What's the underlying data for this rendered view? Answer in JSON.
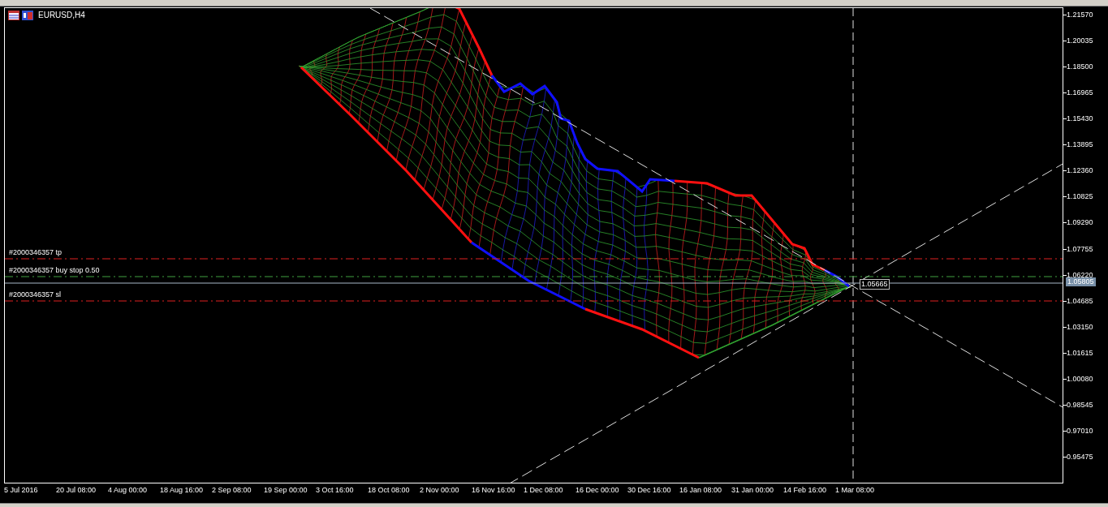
{
  "chart": {
    "title": "EURUSD,H4",
    "price_ticks": [
      "1.21570",
      "1.20035",
      "1.18500",
      "1.16965",
      "1.15430",
      "1.13895",
      "1.12360",
      "1.10825",
      "1.09290",
      "1.07755",
      "1.06220",
      "1.04685",
      "1.03150",
      "1.01615",
      "1.00080",
      "0.98545",
      "0.97010",
      "0.95475"
    ],
    "time_ticks": [
      "5 Jul 2016",
      "20 Jul 08:00",
      "4 Aug 00:00",
      "18 Aug 16:00",
      "2 Sep 08:00",
      "19 Sep 00:00",
      "3 Oct 16:00",
      "18 Oct 08:00",
      "2 Nov 00:00",
      "16 Nov 16:00",
      "1 Dec 08:00",
      "16 Dec 00:00",
      "30 Dec 16:00",
      "16 Jan 08:00",
      "31 Jan 00:00",
      "14 Feb 16:00",
      "1 Mar 08:00"
    ],
    "order_lines": [
      {
        "kind": "tp",
        "label": "#2000346357 tp"
      },
      {
        "kind": "entry",
        "label": "#2000346357 buy stop 0.50"
      },
      {
        "kind": "sl",
        "label": "#2000346357 sl"
      }
    ],
    "bid_price": "1.05805",
    "crosshair_price": "1.05665"
  }
}
